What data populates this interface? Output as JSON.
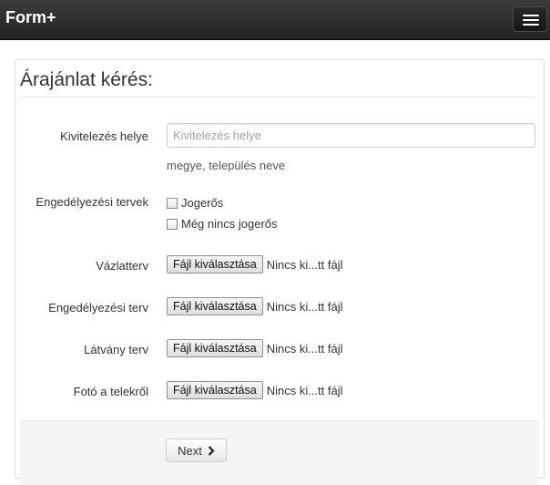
{
  "navbar": {
    "brand": "Form+",
    "menu_icon": "hamburger-menu-icon"
  },
  "form": {
    "title": "Árajánlat kérés:",
    "location": {
      "label": "Kivitelezés helye",
      "placeholder": "Kivitelezés helye",
      "value": "",
      "help": "megye, település neve"
    },
    "permit_plans": {
      "label": "Engedélyezési tervek",
      "options": [
        {
          "label": "Jogerős",
          "checked": false
        },
        {
          "label": "Még nincs jogerős",
          "checked": false
        }
      ]
    },
    "uploads": [
      {
        "label": "Vázlatterv",
        "button": "Fájl kiválasztása",
        "status": "Nincs ki...tt fájl"
      },
      {
        "label": "Engedélyezési terv",
        "button": "Fájl kiválasztása",
        "status": "Nincs ki...tt fájl"
      },
      {
        "label": "Látvány terv",
        "button": "Fájl kiválasztása",
        "status": "Nincs ki...tt fájl"
      },
      {
        "label": "Fotó a telekről",
        "button": "Fájl kiválasztása",
        "status": "Nincs ki...tt fájl"
      }
    ],
    "actions": {
      "next_label": "Next",
      "next_icon": "chevron-right-icon"
    }
  }
}
